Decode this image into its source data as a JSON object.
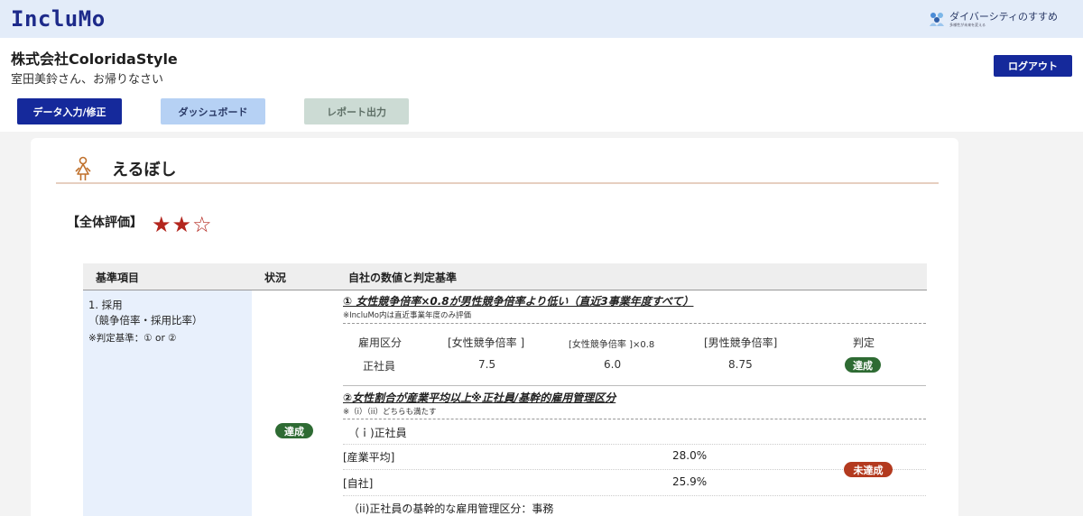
{
  "app": {
    "logo": "IncluMo",
    "brand_title": "ダイバーシティのすすめ",
    "brand_subtitle": "多様性が未来を変える",
    "brand_icon": "diversity-people-icon"
  },
  "header": {
    "company": "株式会社ColoridaStyle",
    "welcome": "室田美鈴さん、お帰りなさい",
    "logout": "ログアウト"
  },
  "nav": {
    "data_input": "データ入力/修正",
    "dashboard": "ダッシュボード",
    "report": "レポート出力"
  },
  "card": {
    "title": "えるぼし",
    "icon": "woman-icon",
    "overall_label": "【全体評価】",
    "stars_display": "★★☆",
    "stars_rating": 2,
    "stars_max": 3
  },
  "table": {
    "headers": [
      "基準項目",
      "状況",
      "自社の数値と判定基準"
    ],
    "criterion": {
      "line1": "1. 採用",
      "line2": "（競争倍率・採用比率）",
      "note": "※判定基準：① or ②"
    },
    "status": "達成",
    "condition1": {
      "title": "① 女性競争倍率×0.8が男性競争倍率より低い（直近3事業年度すべて）",
      "note": "※IncluMo内は直近事業年度のみ評価",
      "columns": [
        "雇用区分",
        "[女性競争倍率 ]",
        "[女性競争倍率 ]×0.8",
        "[男性競争倍率]",
        "判定"
      ],
      "row": {
        "category": "正社員",
        "female_ratio": "7.5",
        "female_ratio_x08": "6.0",
        "male_ratio": "8.75",
        "verdict": "達成"
      }
    },
    "condition2": {
      "title": "②女性割合が産業平均以上※正社員/基幹的雇用管理区分",
      "note": "※（i）（ii）どちらも満たす",
      "sub1": "（ｉ)正社員",
      "industry_label": "[産業平均]",
      "industry_value": "28.0%",
      "company_label": "[自社]",
      "company_value": "25.9%",
      "verdict": "未達成",
      "sub2": "（ii)正社員の基幹的な雇用管理区分：事務"
    }
  },
  "colors": {
    "primary": "#15299b",
    "achieved": "#2e6b33",
    "not_achieved": "#b33a1f",
    "star": "#b3261e"
  }
}
